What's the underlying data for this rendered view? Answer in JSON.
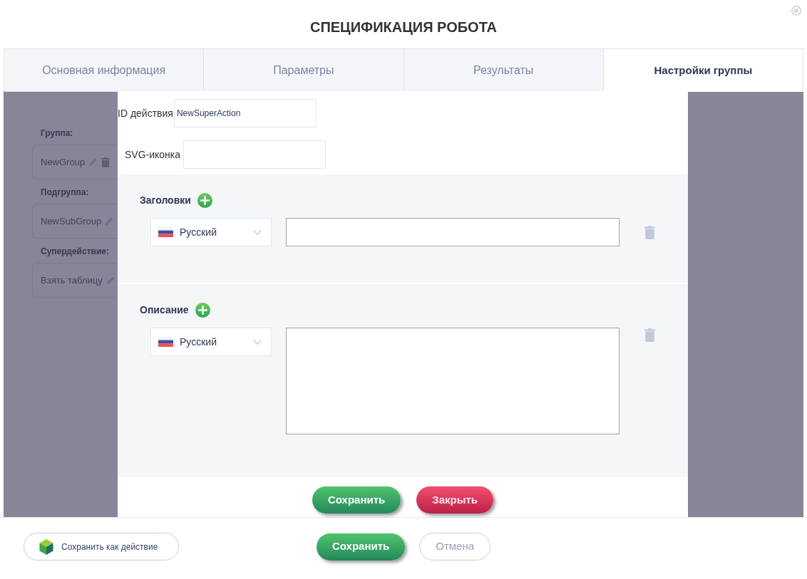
{
  "dialog": {
    "title": "СПЕЦИФИКАЦИЯ РОБОТА"
  },
  "tabs": [
    {
      "label": "Основная информация",
      "selected": false
    },
    {
      "label": "Параметры",
      "selected": false
    },
    {
      "label": "Результаты",
      "selected": false
    },
    {
      "label": "Настройки группы",
      "selected": true
    }
  ],
  "background_panel": {
    "fields": [
      {
        "label": "Группа:",
        "value": "NewGroup",
        "deletable": true
      },
      {
        "label": "Подгруппа:",
        "value": "NewSubGroup",
        "deletable": false
      },
      {
        "label": "Супердействие:",
        "value": "Взять таблицу",
        "deletable": false
      }
    ]
  },
  "modal": {
    "fields": [
      {
        "label": "ID действия",
        "value": "NewSuperAction"
      },
      {
        "label": "SVG-иконка"
      }
    ],
    "sections": [
      {
        "heading": "Заголовки",
        "kind": "line",
        "entries": [
          {
            "language": "Русский"
          }
        ]
      },
      {
        "heading": "Описание",
        "kind": "multiline",
        "entries": [
          {
            "language": "Русский"
          }
        ]
      }
    ],
    "buttons": [
      {
        "label": "Сохранить",
        "kind": "primary"
      },
      {
        "label": "Закрыть",
        "kind": "danger"
      }
    ]
  },
  "footer": {
    "save_as_action": "Сохранить как действие",
    "buttons": [
      {
        "label": "Сохранить",
        "kind": "primary"
      },
      {
        "label": "Отмена",
        "kind": "outline"
      }
    ]
  }
}
